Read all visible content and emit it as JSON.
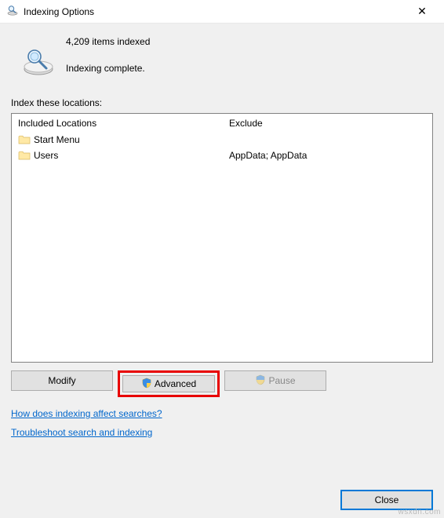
{
  "window": {
    "title": "Indexing Options",
    "close_glyph": "✕"
  },
  "status": {
    "items_indexed": "4,209 items indexed",
    "message": "Indexing complete."
  },
  "section_label": "Index these locations:",
  "columns": {
    "included": "Included Locations",
    "exclude": "Exclude"
  },
  "rows": [
    {
      "name": "Start Menu",
      "exclude": ""
    },
    {
      "name": "Users",
      "exclude": "AppData; AppData"
    }
  ],
  "buttons": {
    "modify": "Modify",
    "advanced": "Advanced",
    "pause": "Pause",
    "close": "Close"
  },
  "links": {
    "how": "How does indexing affect searches?",
    "troubleshoot": "Troubleshoot search and indexing"
  },
  "watermark": "wsxdn.com"
}
